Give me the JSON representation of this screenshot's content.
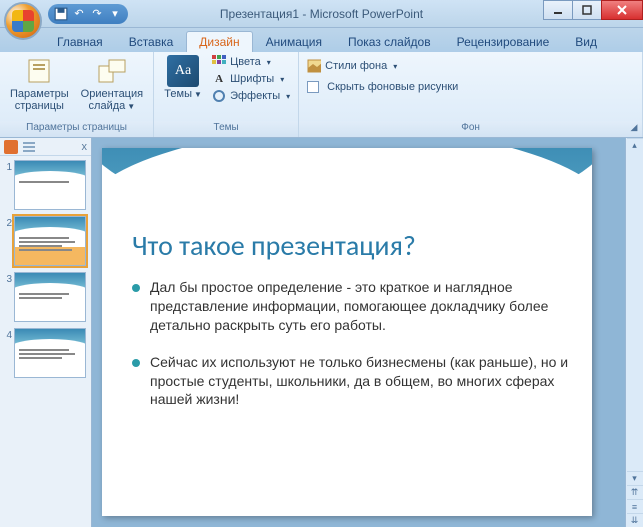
{
  "title": "Презентация1 - Microsoft PowerPoint",
  "tabs": {
    "home": "Главная",
    "insert": "Вставка",
    "design": "Дизайн",
    "animations": "Анимация",
    "slideshow": "Показ слайдов",
    "review": "Рецензирование",
    "view": "Вид"
  },
  "ribbon": {
    "page_setup": {
      "params": "Параметры\nстраницы",
      "orient": "Ориентация\nслайда",
      "group": "Параметры страницы"
    },
    "themes": {
      "themes_btn": "Темы",
      "colors": "Цвета",
      "fonts": "Шрифты",
      "effects": "Эффекты",
      "group": "Темы",
      "sample": "Aa"
    },
    "background": {
      "styles": "Стили фона",
      "hide": "Скрыть фоновые рисунки",
      "group": "Фон"
    }
  },
  "slides": {
    "n1": "1",
    "n2": "2",
    "n3": "3",
    "n4": "4"
  },
  "slide": {
    "title": "Что такое презентация?",
    "b1": "Дал бы простое определение - это краткое и наглядное представление информации, помогающее докладчику более детально раскрыть суть его работы.",
    "b2": "Сейчас их используют не только бизнесмены (как раньше), но и простые студенты, школьники, да в общем, во многих сферах нашей жизни!"
  },
  "pane_close": "x"
}
